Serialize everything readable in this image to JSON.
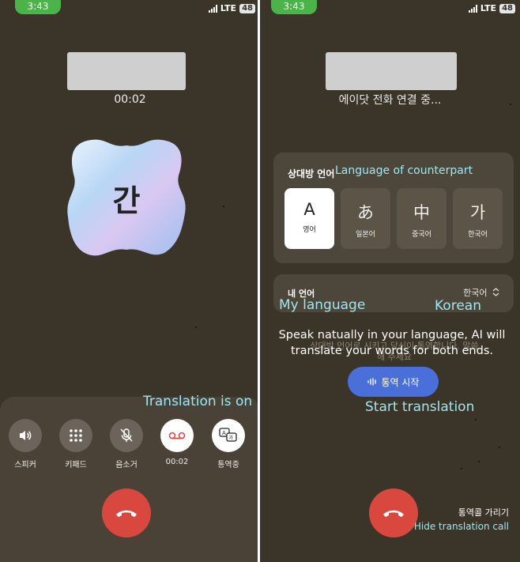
{
  "left_screen": {
    "status": {
      "time": "3:43",
      "network": "LTE",
      "battery": "48"
    },
    "call_timer": "00:02",
    "avatar_letter": "간",
    "annotation_translation_on": "Translation is on",
    "controls": [
      {
        "label": "스피커",
        "icon": "speaker-icon"
      },
      {
        "label": "키패드",
        "icon": "keypad-icon"
      },
      {
        "label": "음소거",
        "icon": "mute-icon"
      },
      {
        "label": "00:02",
        "icon": "record-icon"
      },
      {
        "label": "통역중",
        "icon": "translate-icon"
      }
    ],
    "end_call_icon": "phone-hangup-icon"
  },
  "right_screen": {
    "status": {
      "time": "3:43",
      "network": "LTE",
      "battery": "48"
    },
    "connecting_text": "에이닷 전화 연결 중...",
    "counterpart_title": "상대방 언어",
    "annotation_counterpart": "Language of counterpart",
    "languages": [
      {
        "glyph": "A",
        "name": "영어",
        "selected": true
      },
      {
        "glyph": "あ",
        "name": "일본어",
        "selected": false
      },
      {
        "glyph": "中",
        "name": "중국어",
        "selected": false
      },
      {
        "glyph": "가",
        "name": "한국어",
        "selected": false
      }
    ],
    "my_language_title": "내 언어",
    "my_language_value": "한국어",
    "annotation_my_language": "My language",
    "annotation_korean": "Korean",
    "description_ko": "상대방 언어로 시키고 당신이 통역합니다. 말씀해 주세요",
    "description_en": "Speak natually in your language, AI will translate your words for both ends.",
    "start_button_label": "통역 시작",
    "annotation_start_translation": "Start translation",
    "hide_call_ko": "통역콜 가리기",
    "hide_call_en": "Hide translation call"
  },
  "colors": {
    "background": "#3b3428",
    "status_green": "#4cb34a",
    "accent_blue": "#4a6fd9",
    "annotation_cyan": "#9ee7f2",
    "end_call_red": "#d9483f"
  }
}
